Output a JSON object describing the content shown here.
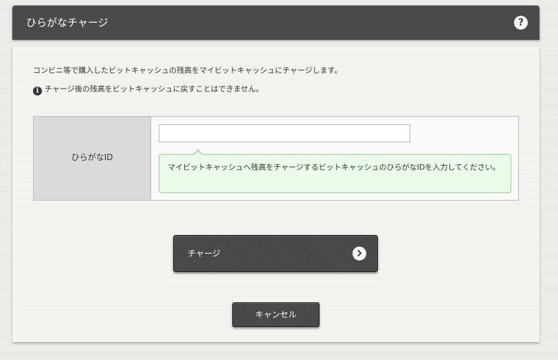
{
  "header": {
    "title": "ひらがなチャージ",
    "help_icon": "?"
  },
  "description": "コンビニ等で購入したビットキャッシュの残高をマイビットキャッシュにチャージします。",
  "notice": {
    "icon": "i",
    "text": "チャージ後の残高をビットキャッシュに戻すことはできません。"
  },
  "form": {
    "label": "ひらがなID",
    "input_value": "",
    "hint": "マイビットキャッシュへ残高をチャージするビットキャッシュのひらがなIDを入力してください。"
  },
  "buttons": {
    "charge_label": "チャージ",
    "cancel_label": "キャンセル"
  },
  "icons": {
    "help": "help-icon",
    "info": "info-icon",
    "arrow": "chevron-right-icon"
  },
  "colors": {
    "header_bg": "#4a4a4a",
    "hint_border": "#8fd28f",
    "hint_bg": "#eafbea",
    "button_bg": "#444444"
  }
}
